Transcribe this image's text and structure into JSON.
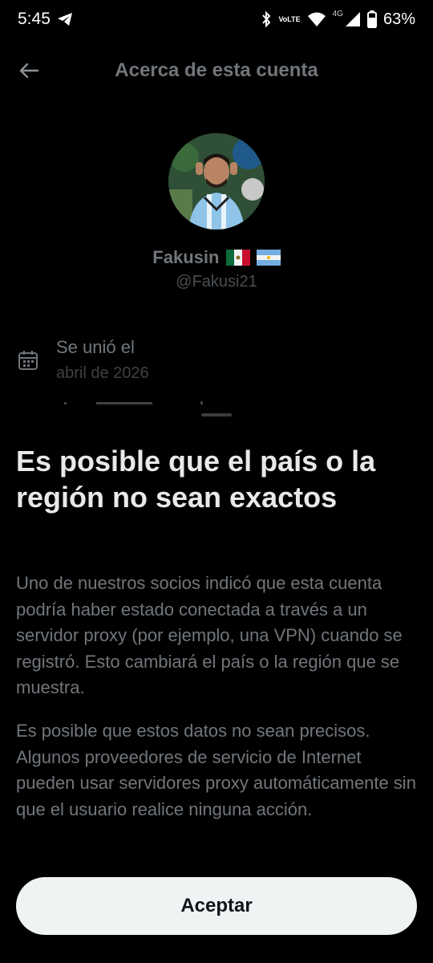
{
  "status_bar": {
    "time": "5:45",
    "volte_top": "Vo",
    "volte_bottom": "LTE",
    "network": "4G",
    "battery": "63%"
  },
  "header": {
    "title": "Acerca de esta cuenta",
    "back_icon": "arrow-left-icon"
  },
  "profile": {
    "display_name": "Fakusin",
    "flags": [
      "mexico-flag",
      "argentina-flag"
    ],
    "handle": "@Fakusi21"
  },
  "joined": {
    "icon": "calendar-icon",
    "label": "Se unió el",
    "value": "abril de 2026"
  },
  "sheet": {
    "title": "Es posible que el país o la región no sean exactos",
    "paragraph1": "Uno de nuestros socios indicó que esta cuenta podría haber estado conectada a través a un servidor proxy (por ejemplo, una VPN) cuando se registró. Esto cambiará el país o la región que se muestra.",
    "paragraph2": "Es posible que estos datos no sean precisos. Algunos proveedores de servicio de Internet pueden usar servidores proxy automáticamente sin que el usuario realice ninguna acción.",
    "accept_label": "Aceptar"
  },
  "colors": {
    "background": "#000000",
    "primary_text": "#e7e9ea",
    "secondary_text": "#71767b",
    "button_bg": "#eff3f4",
    "button_text": "#0f1419"
  }
}
